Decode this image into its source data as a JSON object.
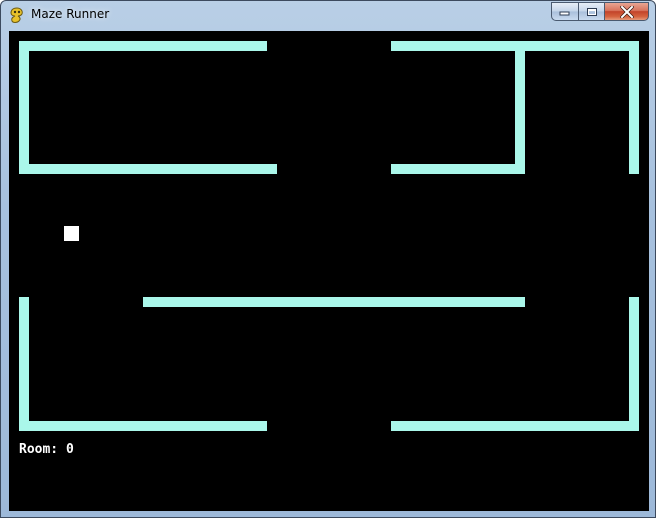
{
  "window": {
    "title": "Maze Runner",
    "app_icon": "pygame-snake-icon",
    "controls": [
      "minimize",
      "maximize",
      "close"
    ]
  },
  "game": {
    "room_label": "Room: 0",
    "colors": {
      "background": "#000000",
      "wall": "#aaf7ea",
      "player": "#ffffff"
    }
  }
}
